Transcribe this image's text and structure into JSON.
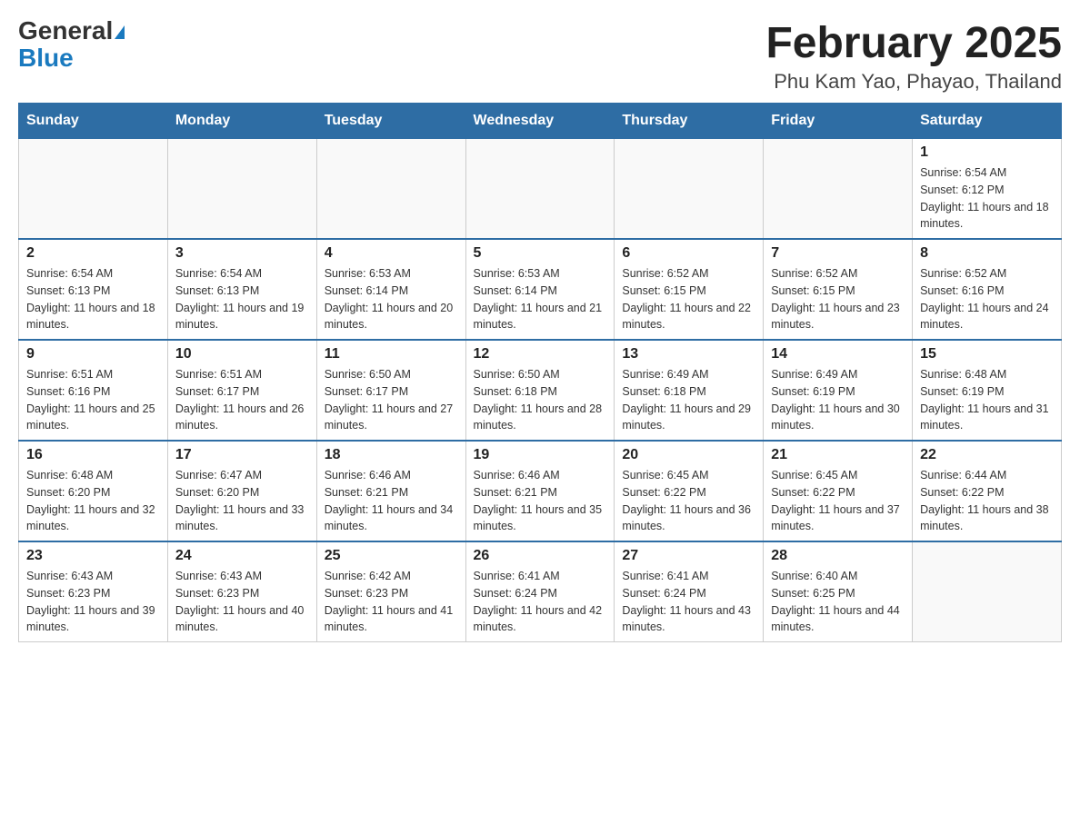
{
  "header": {
    "logo_general": "General",
    "logo_blue": "Blue",
    "month_title": "February 2025",
    "location": "Phu Kam Yao, Phayao, Thailand"
  },
  "weekdays": [
    "Sunday",
    "Monday",
    "Tuesday",
    "Wednesday",
    "Thursday",
    "Friday",
    "Saturday"
  ],
  "weeks": [
    [
      {
        "day": "",
        "info": ""
      },
      {
        "day": "",
        "info": ""
      },
      {
        "day": "",
        "info": ""
      },
      {
        "day": "",
        "info": ""
      },
      {
        "day": "",
        "info": ""
      },
      {
        "day": "",
        "info": ""
      },
      {
        "day": "1",
        "info": "Sunrise: 6:54 AM\nSunset: 6:12 PM\nDaylight: 11 hours and 18 minutes."
      }
    ],
    [
      {
        "day": "2",
        "info": "Sunrise: 6:54 AM\nSunset: 6:13 PM\nDaylight: 11 hours and 18 minutes."
      },
      {
        "day": "3",
        "info": "Sunrise: 6:54 AM\nSunset: 6:13 PM\nDaylight: 11 hours and 19 minutes."
      },
      {
        "day": "4",
        "info": "Sunrise: 6:53 AM\nSunset: 6:14 PM\nDaylight: 11 hours and 20 minutes."
      },
      {
        "day": "5",
        "info": "Sunrise: 6:53 AM\nSunset: 6:14 PM\nDaylight: 11 hours and 21 minutes."
      },
      {
        "day": "6",
        "info": "Sunrise: 6:52 AM\nSunset: 6:15 PM\nDaylight: 11 hours and 22 minutes."
      },
      {
        "day": "7",
        "info": "Sunrise: 6:52 AM\nSunset: 6:15 PM\nDaylight: 11 hours and 23 minutes."
      },
      {
        "day": "8",
        "info": "Sunrise: 6:52 AM\nSunset: 6:16 PM\nDaylight: 11 hours and 24 minutes."
      }
    ],
    [
      {
        "day": "9",
        "info": "Sunrise: 6:51 AM\nSunset: 6:16 PM\nDaylight: 11 hours and 25 minutes."
      },
      {
        "day": "10",
        "info": "Sunrise: 6:51 AM\nSunset: 6:17 PM\nDaylight: 11 hours and 26 minutes."
      },
      {
        "day": "11",
        "info": "Sunrise: 6:50 AM\nSunset: 6:17 PM\nDaylight: 11 hours and 27 minutes."
      },
      {
        "day": "12",
        "info": "Sunrise: 6:50 AM\nSunset: 6:18 PM\nDaylight: 11 hours and 28 minutes."
      },
      {
        "day": "13",
        "info": "Sunrise: 6:49 AM\nSunset: 6:18 PM\nDaylight: 11 hours and 29 minutes."
      },
      {
        "day": "14",
        "info": "Sunrise: 6:49 AM\nSunset: 6:19 PM\nDaylight: 11 hours and 30 minutes."
      },
      {
        "day": "15",
        "info": "Sunrise: 6:48 AM\nSunset: 6:19 PM\nDaylight: 11 hours and 31 minutes."
      }
    ],
    [
      {
        "day": "16",
        "info": "Sunrise: 6:48 AM\nSunset: 6:20 PM\nDaylight: 11 hours and 32 minutes."
      },
      {
        "day": "17",
        "info": "Sunrise: 6:47 AM\nSunset: 6:20 PM\nDaylight: 11 hours and 33 minutes."
      },
      {
        "day": "18",
        "info": "Sunrise: 6:46 AM\nSunset: 6:21 PM\nDaylight: 11 hours and 34 minutes."
      },
      {
        "day": "19",
        "info": "Sunrise: 6:46 AM\nSunset: 6:21 PM\nDaylight: 11 hours and 35 minutes."
      },
      {
        "day": "20",
        "info": "Sunrise: 6:45 AM\nSunset: 6:22 PM\nDaylight: 11 hours and 36 minutes."
      },
      {
        "day": "21",
        "info": "Sunrise: 6:45 AM\nSunset: 6:22 PM\nDaylight: 11 hours and 37 minutes."
      },
      {
        "day": "22",
        "info": "Sunrise: 6:44 AM\nSunset: 6:22 PM\nDaylight: 11 hours and 38 minutes."
      }
    ],
    [
      {
        "day": "23",
        "info": "Sunrise: 6:43 AM\nSunset: 6:23 PM\nDaylight: 11 hours and 39 minutes."
      },
      {
        "day": "24",
        "info": "Sunrise: 6:43 AM\nSunset: 6:23 PM\nDaylight: 11 hours and 40 minutes."
      },
      {
        "day": "25",
        "info": "Sunrise: 6:42 AM\nSunset: 6:23 PM\nDaylight: 11 hours and 41 minutes."
      },
      {
        "day": "26",
        "info": "Sunrise: 6:41 AM\nSunset: 6:24 PM\nDaylight: 11 hours and 42 minutes."
      },
      {
        "day": "27",
        "info": "Sunrise: 6:41 AM\nSunset: 6:24 PM\nDaylight: 11 hours and 43 minutes."
      },
      {
        "day": "28",
        "info": "Sunrise: 6:40 AM\nSunset: 6:25 PM\nDaylight: 11 hours and 44 minutes."
      },
      {
        "day": "",
        "info": ""
      }
    ]
  ]
}
